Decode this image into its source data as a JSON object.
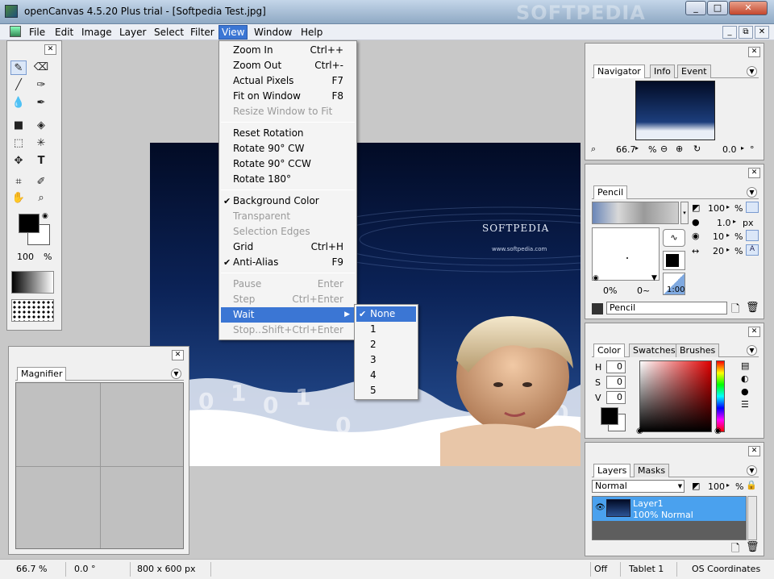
{
  "window": {
    "title": "openCanvas 4.5.20 Plus trial - [Softpedia Test.jpg]",
    "watermark": "SOFTPEDIA"
  },
  "menubar": {
    "items": [
      "File",
      "Edit",
      "Image",
      "Layer",
      "Select",
      "Filter",
      "View",
      "Window",
      "Help"
    ],
    "active": "View"
  },
  "toolbox": {
    "zoom_value": "100",
    "zoom_unit": "%"
  },
  "magnifier": {
    "tab": "Magnifier"
  },
  "navigator": {
    "tabs": [
      "Navigator",
      "Info",
      "Event"
    ],
    "zoom": "66.7",
    "zoom_unit": "%",
    "rotation": "0.0",
    "rotation_unit": "°"
  },
  "pencil": {
    "tab": "Pencil",
    "size": "100",
    "size_unit": "%",
    "min": "1.0",
    "min_unit": "px",
    "density": "10",
    "density_unit": "%",
    "blend": "20",
    "blend_unit": "%",
    "preview_left": "0%",
    "preview_right": "0~",
    "ratio": "1:00",
    "name": "Pencil"
  },
  "color": {
    "tabs": [
      "Color",
      "Swatches",
      "Brushes"
    ],
    "h_label": "H",
    "s_label": "S",
    "v_label": "V",
    "h": "0",
    "s": "0",
    "v": "0"
  },
  "layers": {
    "tabs": [
      "Layers",
      "Masks"
    ],
    "mode": "Normal",
    "opacity": "100",
    "opacity_unit": "%",
    "layer_name": "Layer1",
    "layer_info": "100% Normal"
  },
  "view_menu": {
    "items": [
      {
        "label": "Zoom In",
        "shortcut": "Ctrl++",
        "disabled": false
      },
      {
        "label": "Zoom Out",
        "shortcut": "Ctrl+-",
        "disabled": false
      },
      {
        "label": "Actual Pixels",
        "shortcut": "F7",
        "disabled": false
      },
      {
        "label": "Fit on Window",
        "shortcut": "F8",
        "disabled": false
      },
      {
        "label": "Resize Window to Fit",
        "shortcut": "",
        "disabled": true
      },
      {
        "label": "Reset Rotation",
        "shortcut": "",
        "disabled": false
      },
      {
        "label": "Rotate 90° CW",
        "shortcut": "",
        "disabled": false
      },
      {
        "label": "Rotate 90° CCW",
        "shortcut": "",
        "disabled": false
      },
      {
        "label": "Rotate 180°",
        "shortcut": "",
        "disabled": false
      },
      {
        "label": "Background Color",
        "shortcut": "",
        "disabled": false,
        "checked": true
      },
      {
        "label": "Transparent",
        "shortcut": "",
        "disabled": true
      },
      {
        "label": "Selection Edges",
        "shortcut": "",
        "disabled": true
      },
      {
        "label": "Grid",
        "shortcut": "Ctrl+H",
        "disabled": false
      },
      {
        "label": "Anti-Alias",
        "shortcut": "F9",
        "disabled": false,
        "checked": true
      },
      {
        "label": "Pause",
        "shortcut": "Enter",
        "disabled": true
      },
      {
        "label": "Step",
        "shortcut": "Ctrl+Enter",
        "disabled": true
      },
      {
        "label": "Wait",
        "shortcut": "",
        "disabled": false,
        "highlighted": true
      },
      {
        "label": "Stop...",
        "shortcut": "Shift+Ctrl+Enter",
        "disabled": true
      }
    ]
  },
  "wait_submenu": {
    "items": [
      "None",
      "1",
      "2",
      "3",
      "4",
      "5"
    ],
    "selected": "None"
  },
  "canvas": {
    "brand": "SOFTPEDIA",
    "url": "www.softpedia.com"
  },
  "statusbar": {
    "zoom": "66.7 %",
    "rotation": "0.0 °",
    "size": "800 x 600 px",
    "pressure": "Off",
    "tablet": "Tablet 1",
    "coords": "OS Coordinates"
  },
  "colors": {
    "highlight": "#3b76d4",
    "workspace": "#c8c8c8"
  }
}
